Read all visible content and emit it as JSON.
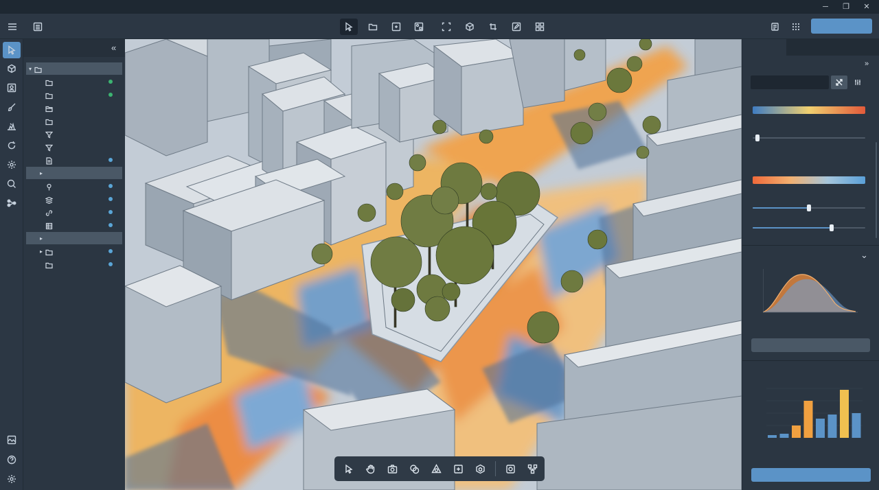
{
  "window": {
    "minimize_glyph": "─",
    "restore_glyph": "❐",
    "close_glyph": "✕"
  },
  "toolbar": {
    "left_icons": [
      "menu-icon",
      "panel-icon"
    ],
    "center_tools": [
      "select-icon",
      "folder-icon",
      "frame-icon",
      "components-icon",
      "marquee-icon",
      "cube-icon",
      "transform-icon",
      "edit-icon",
      "grid-icon"
    ],
    "right_icons": [
      "layers-icon",
      "apps-icon"
    ],
    "primary_label": ""
  },
  "left_rail": {
    "top_icons": [
      "select-icon",
      "cube-icon",
      "image-icon",
      "brush-icon",
      "terrain-icon",
      "refresh-icon",
      "settings-icon",
      "search-icon",
      "nodes-icon"
    ],
    "bottom_icons": [
      "map-icon",
      "help-icon",
      "gear-icon"
    ]
  },
  "tree": {
    "collapse_glyph": "«",
    "rows": [
      {
        "caret": "▾",
        "icon": "folder-icon",
        "indent": 0,
        "selected": true,
        "status": ""
      },
      {
        "caret": "",
        "icon": "folder-icon",
        "indent": 1,
        "selected": false,
        "status": "green"
      },
      {
        "caret": "",
        "icon": "folder-icon",
        "indent": 1,
        "selected": false,
        "status": "green"
      },
      {
        "caret": "",
        "icon": "folder-open-icon",
        "indent": 1,
        "selected": false,
        "status": ""
      },
      {
        "caret": "",
        "icon": "folder-icon",
        "indent": 1,
        "selected": false,
        "status": ""
      },
      {
        "caret": "",
        "icon": "filter-icon",
        "indent": 1,
        "selected": false,
        "status": ""
      },
      {
        "caret": "",
        "icon": "filter-icon",
        "indent": 1,
        "selected": false,
        "status": ""
      },
      {
        "caret": "",
        "icon": "file-icon",
        "indent": 1,
        "selected": false,
        "status": "blue"
      },
      {
        "caret": "▸",
        "icon": "",
        "indent": 1,
        "selected": true,
        "status": ""
      },
      {
        "caret": "",
        "icon": "pin-icon",
        "indent": 1,
        "selected": false,
        "status": "blue"
      },
      {
        "caret": "",
        "icon": "layers-icon",
        "indent": 1,
        "selected": false,
        "status": "blue"
      },
      {
        "caret": "",
        "icon": "link-icon",
        "indent": 1,
        "selected": false,
        "status": "blue"
      },
      {
        "caret": "",
        "icon": "table-icon",
        "indent": 1,
        "selected": false,
        "status": "blue"
      },
      {
        "caret": "▸",
        "icon": "",
        "indent": 1,
        "selected": true,
        "status": ""
      },
      {
        "caret": "▸",
        "icon": "folder-icon",
        "indent": 1,
        "selected": false,
        "status": "blue"
      },
      {
        "caret": "",
        "icon": "folder-icon",
        "indent": 1,
        "selected": false,
        "status": "blue"
      }
    ]
  },
  "bottom_toolbar": {
    "tools": [
      "pointer-icon",
      "hand-icon",
      "camera-icon",
      "overlay-icon",
      "shapes-icon",
      "frame-target-icon",
      "hexagon-icon",
      "snapshot-icon",
      "nodes-icon"
    ]
  },
  "right_panel": {
    "expand_glyph": "»",
    "toggle_icons": [
      "shuffle-icon",
      "sliders-icon"
    ],
    "collapse_glyph": "⌄",
    "gradient_a": [
      "#3f7cc2",
      "#f0d070",
      "#e25a3a"
    ],
    "gradient_b": [
      "#ef6a3a",
      "#f2b070",
      "#a6c6dc",
      "#5aa0d8"
    ],
    "slider_values": [
      0.04,
      0.5,
      0.7
    ],
    "histogram_bars": [
      2,
      3,
      9,
      27,
      14,
      17,
      35,
      18
    ],
    "histogram_colors": [
      "#5b93c7",
      "#5b93c7",
      "#f0a040",
      "#f0a040",
      "#5b93c7",
      "#5b93c7",
      "#f0c050",
      "#5b93c7"
    ],
    "action_label": ""
  },
  "colors": {
    "accent": "#5b93c7",
    "status_green": "#3cb371",
    "status_blue": "#5aa5d6"
  }
}
